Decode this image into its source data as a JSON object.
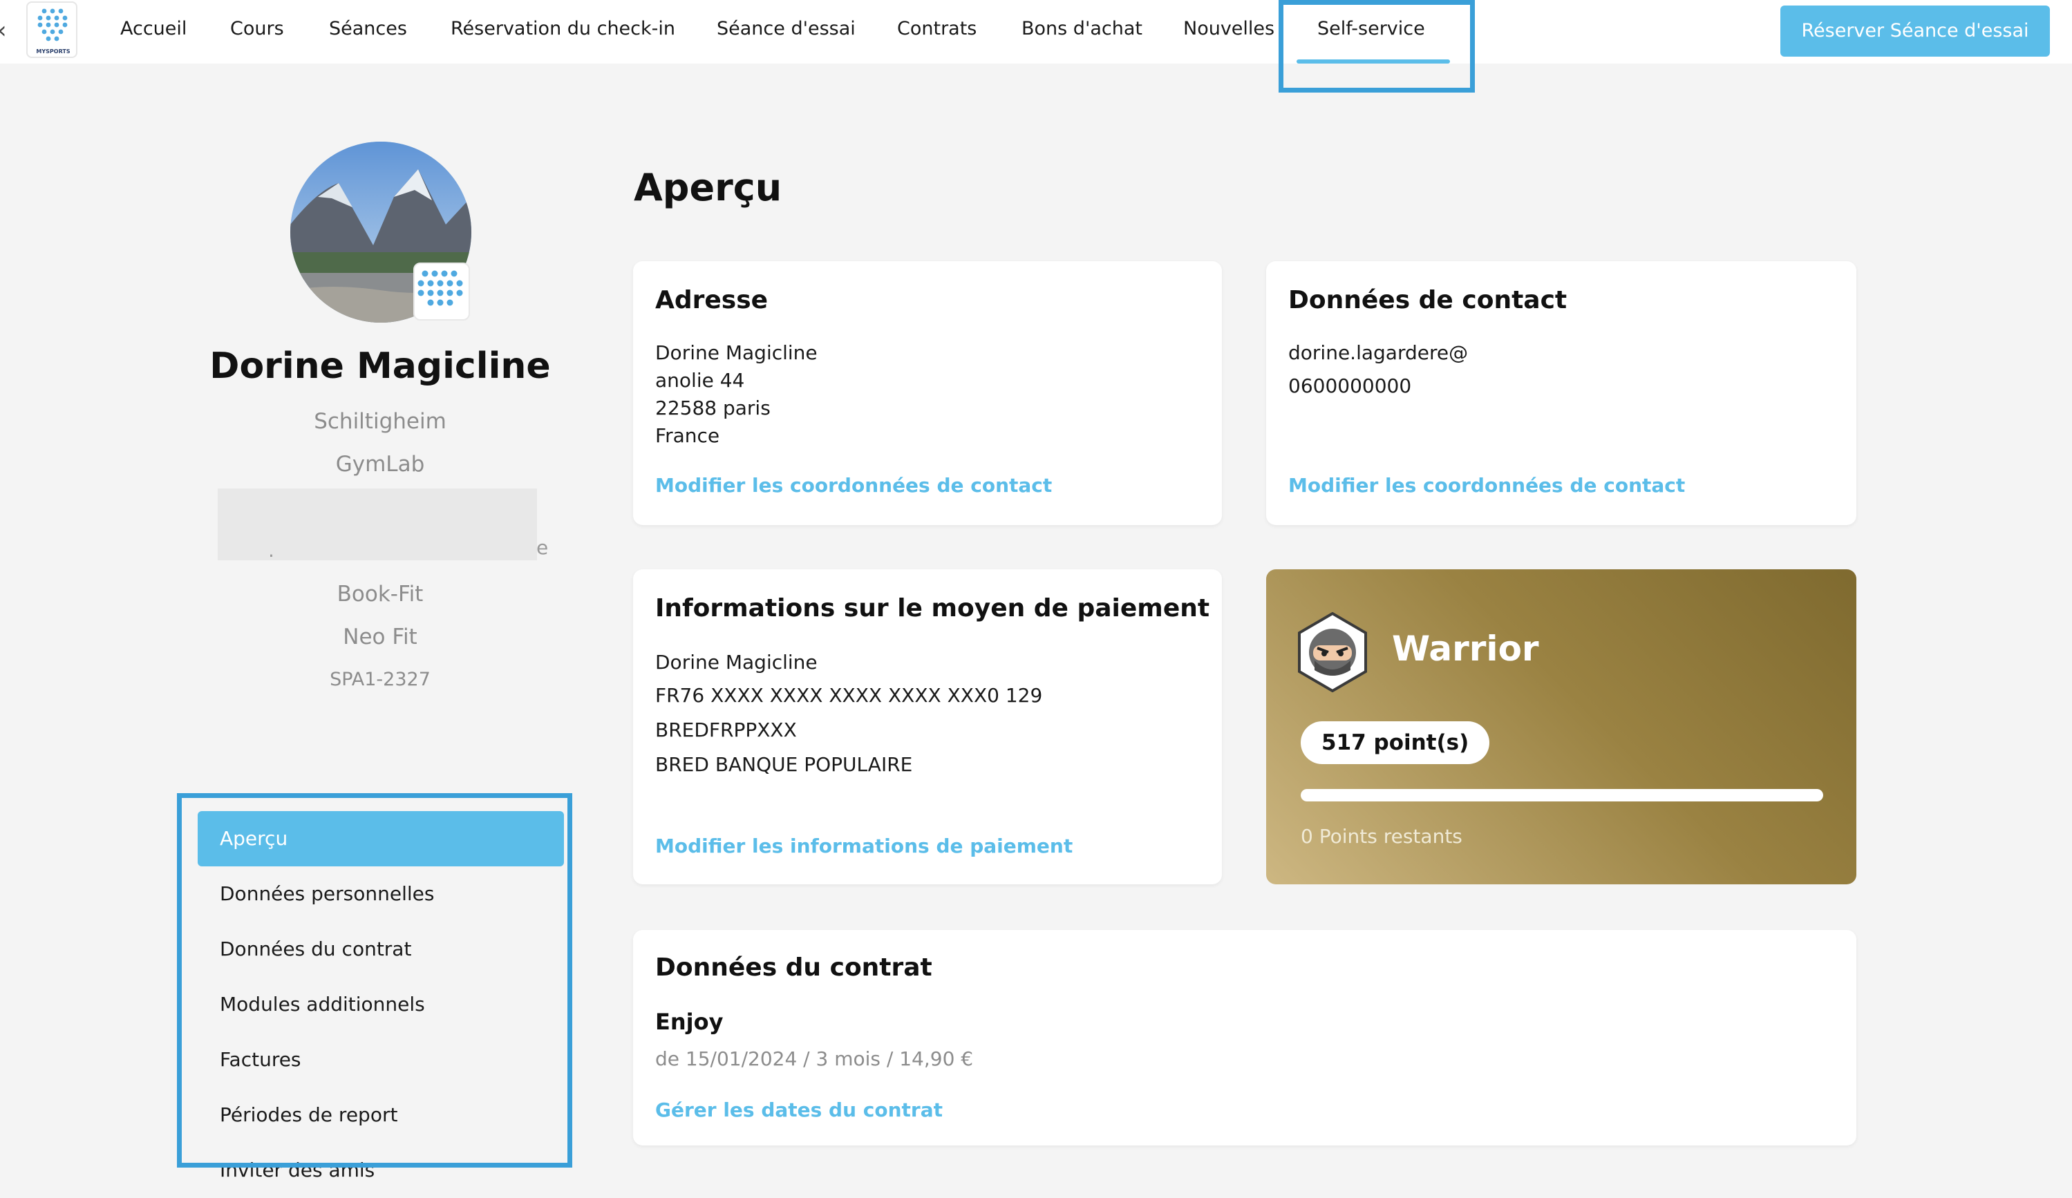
{
  "nav": {
    "logo_text": "MYSPORTS",
    "items": [
      "Accueil",
      "Cours",
      "Séances",
      "Réservation du check-in",
      "Séance d'essai",
      "Contrats",
      "Bons d'achat",
      "Nouvelles",
      "Self-service"
    ],
    "active": "Self-service",
    "cta_label": "Réserver Séance d'essai"
  },
  "profile": {
    "name": "Dorine Magicline",
    "lines": [
      "Schiltigheim",
      "GymLab"
    ],
    "lines_after": [
      "Book-Fit",
      "Neo Fit"
    ],
    "customer_id": "SPA1-2327"
  },
  "sidebar_menu": {
    "items": [
      "Aperçu",
      "Données personnelles",
      "Données du contrat",
      "Modules additionnels",
      "Factures",
      "Périodes de report",
      "Inviter des amis"
    ],
    "active": "Aperçu"
  },
  "main": {
    "title": "Aperçu",
    "address": {
      "title": "Adresse",
      "lines": [
        "Dorine Magicline",
        "anolie 44",
        "22588 paris",
        "France"
      ],
      "link": "Modifier les coordonnées de contact"
    },
    "contact": {
      "title": "Données de contact",
      "email": "dorine.lagardere@",
      "phone": "0600000000",
      "link": "Modifier les coordonnées de contact"
    },
    "payment": {
      "title": "Informations sur le moyen de paiement",
      "lines": [
        "Dorine Magicline",
        "FR76 XXXX XXXX XXXX XXXX XXX0 129",
        "BREDFRPPXXX",
        "BRED BANQUE POPULAIRE"
      ],
      "link": "Modifier les informations de paiement"
    },
    "loyalty": {
      "level": "Warrior",
      "points_label": "517 point(s)",
      "remaining_label": "0 Points restants",
      "progress_fraction": 1.0
    },
    "contract": {
      "title": "Données du contrat",
      "name": "Enjoy",
      "meta": "de 15/01/2024 / 3 mois / 14,90 €",
      "link": "Gérer les dates du contrat"
    }
  },
  "colors": {
    "accent": "#5bbde9",
    "highlight": "#3a9fd8",
    "background": "#f4f4f4"
  }
}
